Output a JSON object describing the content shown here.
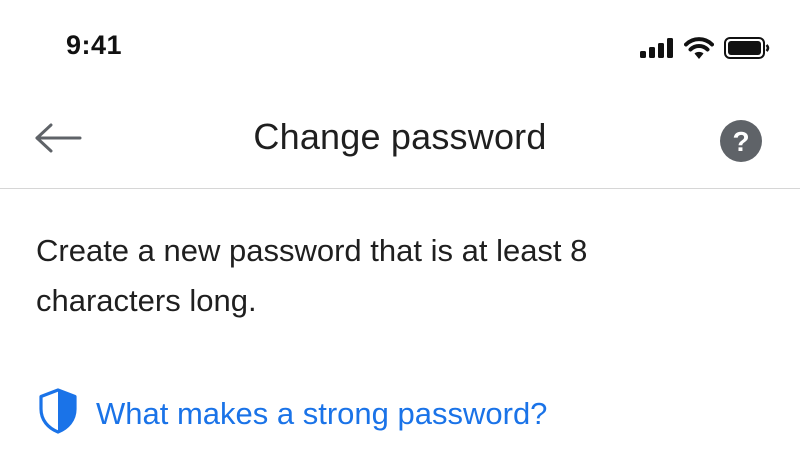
{
  "status_bar": {
    "time": "9:41"
  },
  "header": {
    "title": "Change password",
    "back_icon": "arrow-left-icon",
    "help_icon": "help-circle-icon",
    "help_glyph": "?"
  },
  "content": {
    "description": "Create a new password that is at least 8 characters long.",
    "strong_password_link": "What makes a strong password?",
    "link_icon": "shield-icon"
  },
  "colors": {
    "link": "#1a73e8",
    "help_bg": "#5f6368",
    "divider": "#d6d6d6"
  }
}
